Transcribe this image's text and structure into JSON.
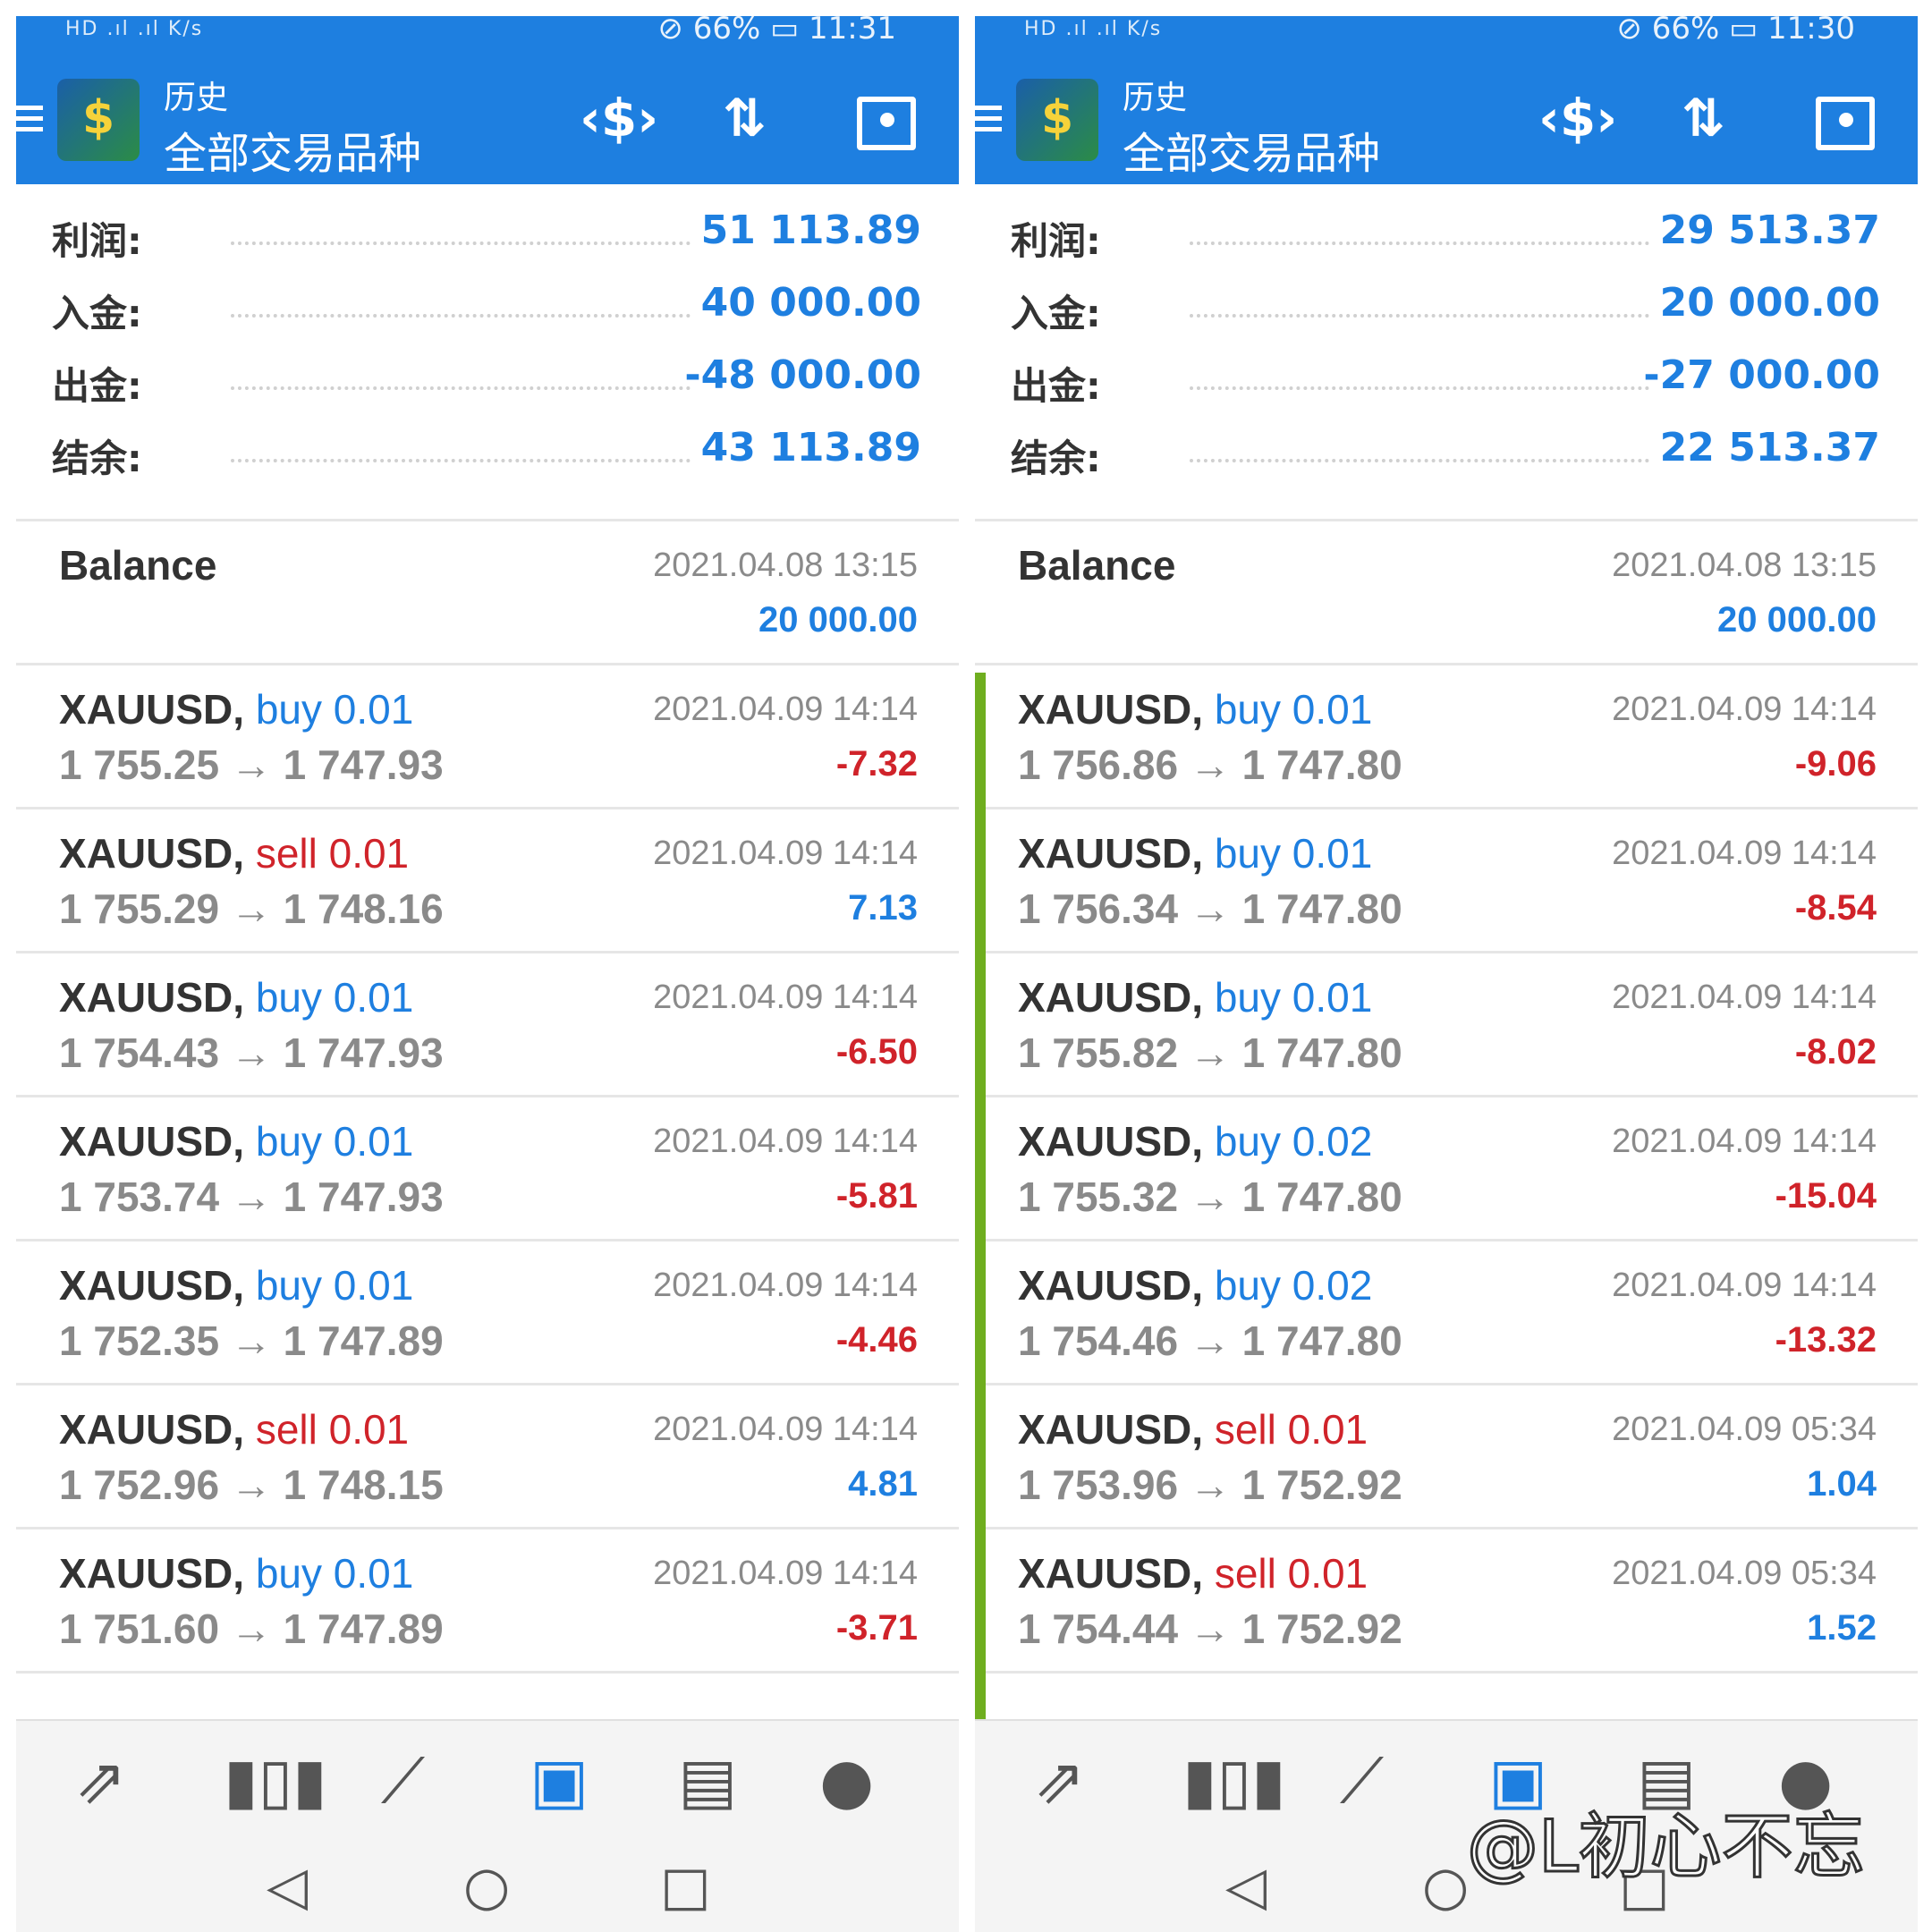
{
  "watermark": "@L初心不忘",
  "panels": [
    {
      "status": {
        "left": "HD  .ıl  .ıl  K/s",
        "right": "⊘ 66% ▭ 11:31"
      },
      "app": {
        "subtitle": "历史",
        "title": "全部交易品种"
      },
      "summary": [
        {
          "label": "利润:",
          "value": "51 113.89"
        },
        {
          "label": "入金:",
          "value": "40 000.00"
        },
        {
          "label": "出金:",
          "value": "-48 000.00"
        },
        {
          "label": "结余:",
          "value": "43 113.89"
        }
      ],
      "balance": {
        "label": "Balance",
        "date": "2021.04.08 13:15",
        "amount": "20 000.00"
      },
      "trades": [
        {
          "symbol": "XAUUSD,",
          "side": "buy 0.01",
          "prices": "1 755.25 → 1 747.93",
          "date": "2021.04.09 14:14",
          "profit": "-7.32"
        },
        {
          "symbol": "XAUUSD,",
          "side": "sell 0.01",
          "prices": "1 755.29 → 1 748.16",
          "date": "2021.04.09 14:14",
          "profit": "7.13"
        },
        {
          "symbol": "XAUUSD,",
          "side": "buy 0.01",
          "prices": "1 754.43 → 1 747.93",
          "date": "2021.04.09 14:14",
          "profit": "-6.50"
        },
        {
          "symbol": "XAUUSD,",
          "side": "buy 0.01",
          "prices": "1 753.74 → 1 747.93",
          "date": "2021.04.09 14:14",
          "profit": "-5.81"
        },
        {
          "symbol": "XAUUSD,",
          "side": "buy 0.01",
          "prices": "1 752.35 → 1 747.89",
          "date": "2021.04.09 14:14",
          "profit": "-4.46"
        },
        {
          "symbol": "XAUUSD,",
          "side": "sell 0.01",
          "prices": "1 752.96 → 1 748.15",
          "date": "2021.04.09 14:14",
          "profit": "4.81"
        },
        {
          "symbol": "XAUUSD,",
          "side": "buy 0.01",
          "prices": "1 751.60 → 1 747.89",
          "date": "2021.04.09 14:14",
          "profit": "-3.71"
        }
      ]
    },
    {
      "status": {
        "left": "HD  .ıl  .ıl  K/s",
        "right": "⊘ 66% ▭ 11:30"
      },
      "app": {
        "subtitle": "历史",
        "title": "全部交易品种"
      },
      "summary": [
        {
          "label": "利润:",
          "value": "29 513.37"
        },
        {
          "label": "入金:",
          "value": "20 000.00"
        },
        {
          "label": "出金:",
          "value": "-27 000.00"
        },
        {
          "label": "结余:",
          "value": "22 513.37"
        }
      ],
      "balance": {
        "label": "Balance",
        "date": "2021.04.08 13:15",
        "amount": "20 000.00"
      },
      "trades": [
        {
          "symbol": "XAUUSD,",
          "side": "buy 0.01",
          "prices": "1 756.86 → 1 747.80",
          "date": "2021.04.09 14:14",
          "profit": "-9.06"
        },
        {
          "symbol": "XAUUSD,",
          "side": "buy 0.01",
          "prices": "1 756.34 → 1 747.80",
          "date": "2021.04.09 14:14",
          "profit": "-8.54"
        },
        {
          "symbol": "XAUUSD,",
          "side": "buy 0.01",
          "prices": "1 755.82 → 1 747.80",
          "date": "2021.04.09 14:14",
          "profit": "-8.02"
        },
        {
          "symbol": "XAUUSD,",
          "side": "buy 0.02",
          "prices": "1 755.32 → 1 747.80",
          "date": "2021.04.09 14:14",
          "profit": "-15.04"
        },
        {
          "symbol": "XAUUSD,",
          "side": "buy 0.02",
          "prices": "1 754.46 → 1 747.80",
          "date": "2021.04.09 14:14",
          "profit": "-13.32"
        },
        {
          "symbol": "XAUUSD,",
          "side": "sell 0.01",
          "prices": "1 753.96 → 1 752.92",
          "date": "2021.04.09 05:34",
          "profit": "1.04"
        },
        {
          "symbol": "XAUUSD,",
          "side": "sell 0.01",
          "prices": "1 754.44 → 1 752.92",
          "date": "2021.04.09 05:34",
          "profit": "1.52"
        }
      ]
    }
  ],
  "icons": {
    "appbar": [
      "currency-exchange-icon",
      "sort-icon",
      "calendar-icon"
    ],
    "bottom_nav": [
      "trade-arrows-icon",
      "quotes-icon",
      "chart-icon",
      "history-icon",
      "news-icon",
      "chat-icon"
    ],
    "system": [
      "back-icon",
      "home-icon",
      "recents-icon"
    ]
  },
  "colors": {
    "accent": "#1e7fe0",
    "negative": "#d0232a",
    "selected_bar": "#6fae1f"
  }
}
